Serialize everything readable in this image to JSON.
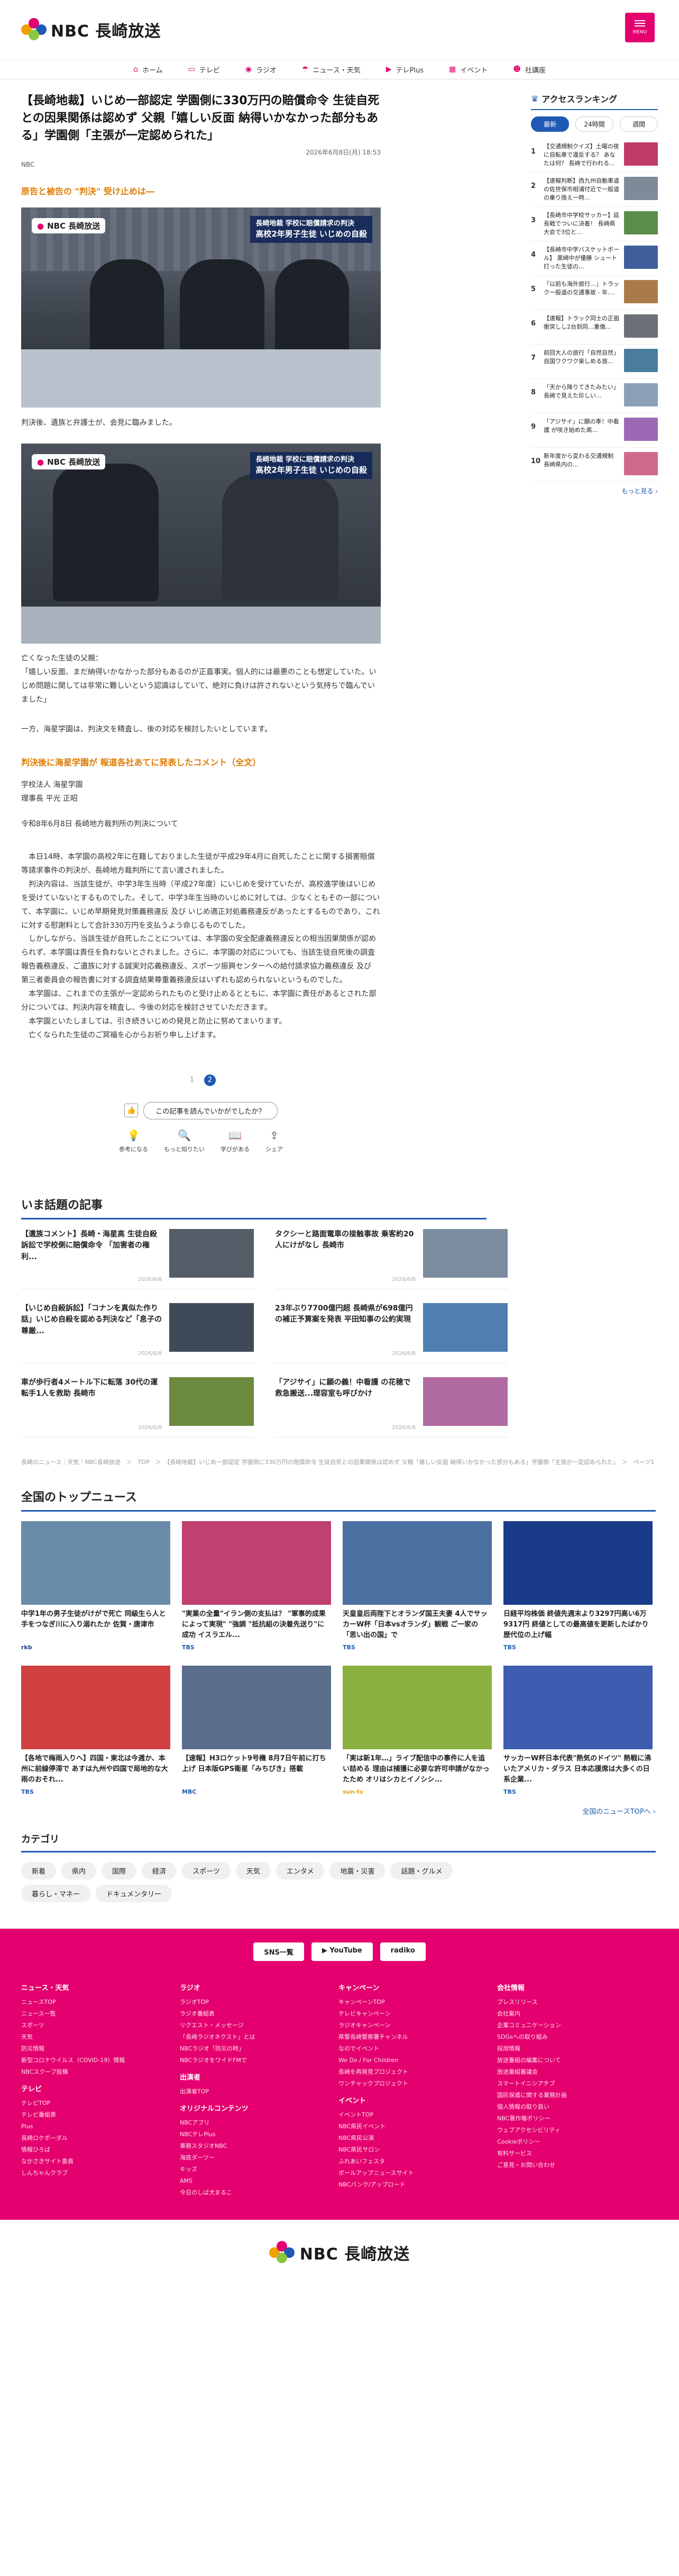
{
  "header": {
    "logo_text": "NBC 長崎放送",
    "menu_label": "MENU"
  },
  "gnav": [
    {
      "label": "ホーム",
      "icon": "⌂"
    },
    {
      "label": "テレビ",
      "icon": "▭"
    },
    {
      "label": "ラジオ",
      "icon": "◉"
    },
    {
      "label": "ニュース・天気",
      "icon": "☂"
    },
    {
      "label": "テレPlus",
      "icon": "▶"
    },
    {
      "label": "イベント",
      "icon": "▦"
    },
    {
      "label": "社講座",
      "icon": "☻"
    }
  ],
  "article": {
    "title": "【長崎地裁】いじめ一部認定 学園側に330万円の賠償命令 生徒自死との因果関係は認めず 父親「嬉しい反面 納得いかなかった部分もある」学園側「主張が一定認められた」",
    "date": "2026年6月8日(月) 18:53",
    "byline": "NBC",
    "sub_head_1": "原告と被告の \"判決\" 受け止めは―",
    "photo_badge": "NBC 長崎放送",
    "photo_cap1_l1": "長崎地裁 学校に賠償請求の判決",
    "photo_cap1_l2": "高校2年男子生徒 いじめの自殺",
    "caption_1": "判決後、遺族と弁護士が、会見に臨みました。",
    "caption_2": "亡くなった生徒の父親：\n「嬉しい反面、まだ納得いかなかった部分もあるのが正直事実。個人的には最悪のことも想定していた。いじめ問題に関しては非常に難しいという認識はしていて、絶対に負けは許されないという気持ちで臨んでいました」",
    "para_1": "一方、海星学園は、判決文を精査し、後の対応を検討したいとしています。",
    "orange_head": "判決後に海星学園が 報道各社あてに発表したコメント（全文）",
    "org": "学校法人 海星学園\n理事長 平光 正昭",
    "date_line": "令和8年6月8日 長崎地方裁判所の判決について",
    "body": "　本日14時、本学園の高校2年に在籍しておりました生徒が平成29年4月に自死したことに関する損害賠償等請求事件の判決が、長崎地方裁判所にて言い渡されました。\n　判決内容は、当該生徒が、中学3年生当時（平成27年度）にいじめを受けていたが、高校進学後はいじめを受けていないとするものでした。そして、中学3年生当時のいじめに対しては、少なくともその一部について、本学園に、いじめ早期発見対策義務違反 及び いじめ適正対処義務違反があったとするものであり、これに対する慰謝料として合計330万円を支払うよう命じるものでした。\n　しかしながら、当該生徒が自死したことについては、本学園の安全配慮義務違反との相当因果関係が認められず、本学園は責任を負わないとされました。さらに、本学園の対応についても、当該生徒自死後の調査報告義務違反、ご遺族に対する誠実対応義務違反、スポーツ振興センターへの給付請求協力義務違反 及び 第三者委員会の報告書に対する調査結果尊重義務違反はいずれも認められないというものでした。\n　本学園は、これまでの主張が一定認められたものと受け止めるとともに、本学園に責任があるとされた部分については、判決内容を精査し、今後の対応を検討させていただきます。\n　本学園といたしましては、引き続きいじめの発見と防止に努めてまいります。\n　亡くなられた生徒のご冥福を心からお祈り申し上げます。"
  },
  "pager": [
    "1",
    "2"
  ],
  "feedback": {
    "label": "この記事を読んでいかがでしたか？"
  },
  "reactions": [
    {
      "label": "参考になる",
      "icon": "💡"
    },
    {
      "label": "もっと知りたい",
      "icon": "🔍"
    },
    {
      "label": "学びがある",
      "icon": "📖"
    },
    {
      "label": "シェア",
      "icon": "⇪"
    }
  ],
  "side": {
    "title": "アクセスランキング",
    "tabs": [
      "最新",
      "24時間",
      "週間"
    ],
    "items": [
      {
        "no": "1",
        "text": "【交通規制クイズ】土曜の夜に自転車で違反する？ あなたは何？ 長崎で行われる..."
      },
      {
        "no": "2",
        "text": "【速報判断】西九州自動車道の佐世保市相浦付近で一般道の乗り換え一時..."
      },
      {
        "no": "3",
        "text": "【長崎市中学校サッカー】延長戦でついに決着！ 長崎県大会で3位と..."
      },
      {
        "no": "4",
        "text": "【長崎市中学バスケットボール】 黒崎中が優勝 シュート打った生徒の..."
      },
      {
        "no": "5",
        "text": "「以前も海外旅行…」トラック一般道の交通事故 - 年...."
      },
      {
        "no": "6",
        "text": "【速報】トラック同士の正面衝突しし2台到同…重傷..."
      },
      {
        "no": "7",
        "text": "前回大人の旅行「自然自然」 自国ワクワク楽しめる旅..."
      },
      {
        "no": "8",
        "text": "「天から降りてきたみたい」 長崎で見えた珍しい..."
      },
      {
        "no": "9",
        "text": "「アジサイ」に願の季！中看護 が咲き始めた高..."
      },
      {
        "no": "10",
        "text": "新年度から変わる交通規制 長崎県内の..."
      }
    ],
    "more": "もっと見る ›"
  },
  "topics": {
    "title": "いま話題の記事",
    "items": [
      {
        "text": "【遺族コメント】長崎・海星高 生徒自殺訴訟で学校側に賠償命令 「加害者の権利...",
        "date": "2026/6/8"
      },
      {
        "text": "タクシーと路面電車の接触事故 乗客約20人にけがなし 長崎市",
        "date": "2026/6/8"
      },
      {
        "text": "【いじめ自殺訴訟】「コナンを真似た作り話」いじめ自殺を認める判決など「息子の尊厳...",
        "date": "2026/6/8"
      },
      {
        "text": "23年ぶり7700億円超 長崎県が698億円の補正予算案を発表 平田知事の公約実現",
        "date": "2026/6/8"
      },
      {
        "text": "車が歩行者4メートル下に転落 30代の運転手1人を救助 長崎市",
        "date": "2026/6/8"
      },
      {
        "text": "「アジサイ」に願の義！中看護 の花穂で救急搬送...理容室も呼びかけ",
        "date": "2026/6/8"
      }
    ]
  },
  "breadcrumb": "長崎のニュース｜天気｜NBC長崎放送　＞　TOP　＞　【長崎地裁】いじめ一部認定 学園側に330万円の賠償命令 生徒自死との因果関係は認めず 父親「嬉しい反面 納得いかなかった部分もある」学園側「主張が一定認められた」　＞　ページ1",
  "top_news": {
    "title": "全国のトップニュース",
    "items": [
      {
        "text": "中学1年の男子生徒がけがで死亡 同級生ら人と手をつなぎ川に入り溺れたか 佐賀・唐津市",
        "src": "rkb",
        "srccolor": "#1e3f8c",
        "date": ""
      },
      {
        "text": "\"実業の全量\"イラン側の支払は？ \"軍事的成果によって実現\" \"強調 \"抵抗組の決着先送り\"に成功 イスラエル...",
        "src": "TBS",
        "srccolor": "#1e5ab4",
        "date": ""
      },
      {
        "text": "天皇皇后両陛下とオランダ国王夫妻 4人でサッカーW杯「日本vsオランダ」観戦 ご一家の「思い出の国」で",
        "src": "TBS",
        "srccolor": "#1e5ab4",
        "date": ""
      },
      {
        "text": "日経平均株価 終値先週末より3297円高い6万9317円 終値としての最高値を更新したばかり歴代位の上げ幅",
        "src": "TBS",
        "srccolor": "#1e5ab4",
        "date": ""
      },
      {
        "text": "【各地で梅雨入りへ】四国・東北は今週か、本州に前線停滞で あすは九州や四国で局地的な大雨のおそれ...",
        "src": "TBS",
        "srccolor": "#1e5ab4",
        "date": ""
      },
      {
        "text": "【速報】H3ロケット9号機 8月7日午前に打ち上げ 日本版GPS衛星「みちびき」搭載",
        "src": "MBC",
        "srccolor": "#1e5ab4",
        "date": ""
      },
      {
        "text": "「実は新1年…」ライブ配信中の事件に人を追い詰める 理由は捕獲に必要な許可申請がなかったため オリはシカとイノシシ...",
        "src": "sun-tv",
        "srccolor": "#f0a000",
        "date": ""
      },
      {
        "text": "サッカーW杯日本代表\"熱気のドイツ\" 熱戦に沸いたアメリカ・ダラス 日本応援席は大多くの日系企業...",
        "src": "TBS",
        "srccolor": "#1e5ab4",
        "date": ""
      }
    ],
    "all": "全国のニュースTOPへ ›"
  },
  "categories": {
    "title": "カテゴリ",
    "items": [
      "新着",
      "県内",
      "国際",
      "経済",
      "スポーツ",
      "天気",
      "エンタメ",
      "地震・災害",
      "話題・グルメ",
      "暮らし・マネー",
      "ドキュメンタリー"
    ]
  },
  "footer": {
    "buttons": [
      "SNS一覧",
      "▶ YouTube",
      "radiko"
    ],
    "cols": [
      {
        "head": "ニュース・天気",
        "links": [
          "ニュースTOP",
          "ニュース一覧",
          "スポーツ",
          "天気",
          "防災情報",
          "新型コロナウイルス（COVID-19）情報",
          "NBCスクープ投稿"
        ],
        "head2": "テレビ",
        "links2": [
          "テレビTOP",
          "テレビ番組表",
          "Plus",
          "長崎ロケポーダル",
          "情報ひろば",
          "なかさきサイト委員",
          "しんちゃんクラブ"
        ]
      },
      {
        "head": "ラジオ",
        "links": [
          "ラジオTOP",
          "ラジオ番組表",
          "リクエスト・メッセージ",
          "「長崎ラジオネクスト」とは",
          "NBCラジオ「防災の時」",
          "NBCラジオをワイドFMで"
        ],
        "head2": "出演者",
        "links2": [
          "出演者TOP"
        ],
        "head3": "オリジナルコンテンツ",
        "links3": [
          "NBCアプリ",
          "NBCテレPlus",
          "事務スタジオNBC",
          "海底ダーツー",
          "キッズ",
          "AMS",
          "今日のしば犬まるこ"
        ]
      },
      {
        "head": "キャンペーン",
        "links": [
          "キャンペーンTOP",
          "テレビキャンペーン",
          "ラジオキャンペーン",
          "県警長崎警察署チャンネル",
          "なのでイベント",
          "We Do / For Children",
          "長崎を再発見プロジェクト",
          "ワンチャックプロジェクト"
        ],
        "head2": "イベント",
        "links2": [
          "イベントTOP",
          "NBC県民イベント",
          "NBC県民公演",
          "NBC県民サロン",
          "ふれあいフェスタ",
          "ボールアップニュースサイト",
          "NBCバンク/アップロード"
        ]
      },
      {
        "head": "会社情報",
        "links": [
          "プレスリリース",
          "会社案内",
          "企業コミュニケーション",
          "SDGsへの取り組み",
          "採用情報",
          "放送番組の編集について",
          "放送番組審議会",
          "スマートイニシアチブ",
          "国民保護に関する業務計画",
          "個人情報の取り扱い",
          "NBC著作権ポリシー",
          "ウェブアクセシビリティ",
          "Cookieポリシー",
          "有料サービス",
          "ご意見・お問い合わせ"
        ]
      }
    ]
  }
}
